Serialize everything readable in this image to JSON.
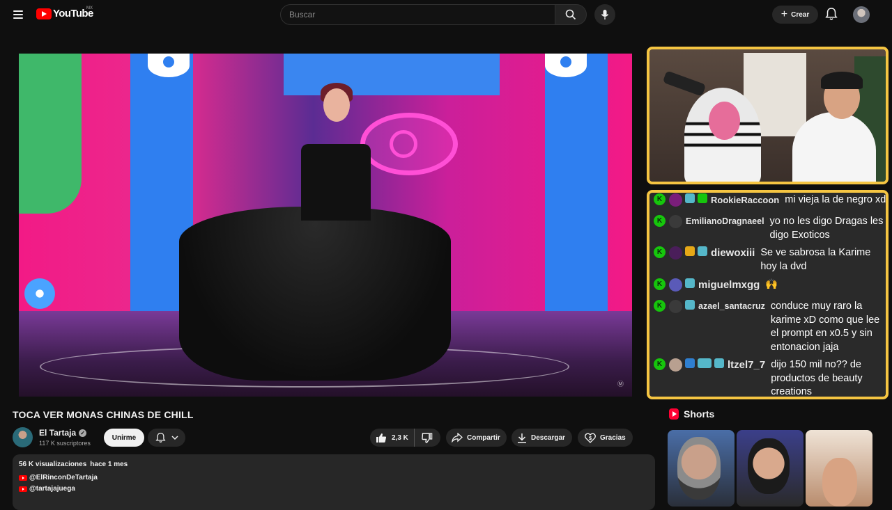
{
  "app": {
    "logo_text": "YouTube",
    "country": "MX"
  },
  "header": {
    "search_placeholder": "Buscar",
    "create_label": "Crear"
  },
  "player": {
    "watermark": "Ⓜ︎"
  },
  "video": {
    "title": "TOCA VER MONAS CHINAS DE CHILL",
    "channel_name": "El Tartaja",
    "subscribers": "117 K suscriptores",
    "join_label": "Unirme",
    "likes": "2,3 K",
    "share_label": "Compartir",
    "download_label": "Descargar",
    "thanks_label": "Gracias"
  },
  "description": {
    "views": "56 K visualizaciones",
    "age": "hace 1 mes",
    "links": [
      "@ElRinconDeTartaja",
      "@tartajajuega"
    ]
  },
  "chat": {
    "messages": [
      {
        "user": "RookieRaccoon",
        "text": "mi vieja la de negro xd"
      },
      {
        "user": "EmilianoDragnaeel",
        "text": "yo no les digo Dragas les digo Exoticos"
      },
      {
        "user": "diewoxiii",
        "text": "Se ve sabrosa la Karime hoy la dvd"
      },
      {
        "user": "miguelmxgg",
        "text": "🙌"
      },
      {
        "user": "azael_santacruz",
        "text": "conduce muy raro la karime xD como que lee el prompt en x0.5 y sin entonacion jaja"
      },
      {
        "user": "ltzel7_7",
        "text": "dijo 150 mil no?? de productos de beauty creations"
      }
    ]
  },
  "shorts": {
    "title": "Shorts"
  },
  "colors": {
    "accent_border": "#f5c542",
    "chat_badge": "#16c60c",
    "youtube_red": "#ff0000"
  }
}
